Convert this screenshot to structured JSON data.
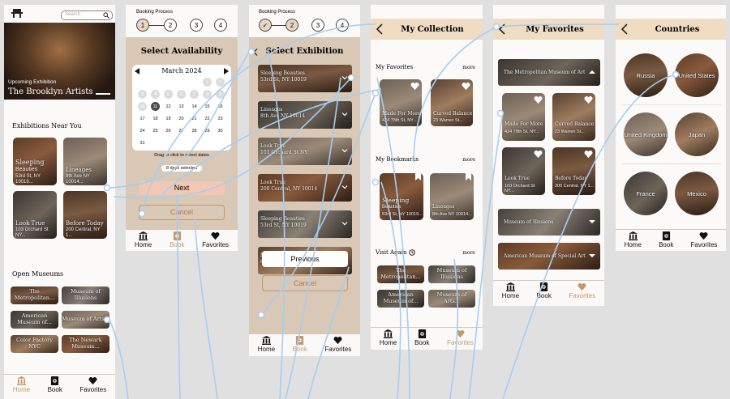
{
  "screen1": {
    "search_placeholder": "Search",
    "hero_kicker": "Upcoming Exhibition",
    "hero_title": "The Brooklyn Artists",
    "section_exhibitions": "Exhibitions Near You",
    "exhibitions": [
      {
        "title": "Sleeping",
        "subtitle": "Beauties",
        "address": "53rd St, NY 10019..."
      },
      {
        "title": "Lineages",
        "subtitle": "",
        "address": "8th Ave NY 10014..."
      },
      {
        "title": "Look True",
        "subtitle": "",
        "address": "103 Orchard St NY..."
      },
      {
        "title": "Before Today",
        "subtitle": "",
        "address": "200 Central, NY 1..."
      }
    ],
    "section_museums": "Open Museums",
    "museums": [
      "The Metropolitan...",
      "Museum of Illusions",
      "American Museum of...",
      "Museum of Arts...",
      "Color Factory NYC",
      "The Newark Museum..."
    ],
    "nav": [
      "Home",
      "Book",
      "Favorites"
    ]
  },
  "screen2": {
    "process_label": "Booking Process",
    "steps": [
      "1",
      "2",
      "3",
      "4"
    ],
    "title": "Select Availability",
    "month": "March 2024",
    "days": [
      "1",
      "2",
      "3",
      "4",
      "5",
      "6",
      "7",
      "8",
      "9",
      "10",
      "11",
      "12",
      "13",
      "14",
      "15",
      "16",
      "17",
      "18",
      "19",
      "20",
      "21",
      "22",
      "23",
      "24",
      "25",
      "26",
      "27",
      "28",
      "29",
      "30",
      "31"
    ],
    "selected_day": "11",
    "hint": "Drag or click to select dates",
    "days_selected": "8 days selected",
    "next_label": "Next",
    "cancel_label": "Cancel",
    "nav": [
      "Home",
      "Book",
      "Favorites"
    ]
  },
  "screen3": {
    "process_label": "Booking Process",
    "steps": [
      "✓",
      "2",
      "3",
      "4"
    ],
    "title": "Select Exhibition",
    "items": [
      {
        "title": "Sleeping Beauties",
        "address": "53rd St, NY 10019"
      },
      {
        "title": "Lineages",
        "address": "8th Ave NY 10014"
      },
      {
        "title": "Look True",
        "address": "103 Orchard St NY"
      },
      {
        "title": "Look True",
        "address": "200 Central, NY 10014"
      },
      {
        "title": "Sleeping Beauties",
        "address": "53rd St, NY 10019"
      },
      {
        "title": "Lineages",
        "address": "8th Ave NY 10014"
      }
    ],
    "previous_label": "Previous",
    "cancel_label": "Cancel",
    "nav": [
      "Home",
      "Book",
      "Favorites"
    ]
  },
  "screen4": {
    "title": "My Collection",
    "favorites_head": "My Favorites",
    "bookmarks_head": "My Bookmarks",
    "visit_head": "Visit Again",
    "more": "more",
    "favorites": [
      {
        "title": "Made For More",
        "address": "424 78th St, NY..."
      },
      {
        "title": "Curved Balance",
        "address": "23 Warren St..."
      }
    ],
    "bookmarks": [
      {
        "title": "Sleeping",
        "subtitle": "Beauties",
        "address": "53rd St, NY 10019..."
      },
      {
        "title": "Lineages",
        "subtitle": "",
        "address": "8th Ave NY 10014..."
      }
    ],
    "visit": [
      "The Metropolitan...",
      "Museum of Illusions",
      "American Museum of...",
      "Museum of Arts..."
    ],
    "nav": [
      "Home",
      "Book",
      "Favorites"
    ]
  },
  "screen5": {
    "title": "My Favorites",
    "museum_open": "The Metropolitan Museum of Art",
    "items": [
      {
        "title": "Made For More",
        "address": "424 78th St, NY..."
      },
      {
        "title": "Curved Balance",
        "address": "23 Warren St..."
      },
      {
        "title": "Look True",
        "address": "103 Orchard St NY..."
      },
      {
        "title": "Before Today",
        "address": "200 Central, NY 1..."
      }
    ],
    "museum_2": "Museum of Illusions",
    "museum_3": "American Museum of Special Art",
    "nav": [
      "Home",
      "Book",
      "Favorites"
    ]
  },
  "screen6": {
    "title": "Countries",
    "countries": [
      "Russia",
      "United States",
      "United Kingdom",
      "Japan",
      "France",
      "Mexico"
    ],
    "nav": [
      "Home",
      "Book",
      "Favorites"
    ]
  },
  "colors": {
    "background": "#e0e0e0",
    "accent": "#c19a6b",
    "panel": "#d8c8b5",
    "banner": "#efdcc2",
    "wire": "#a8cdf0",
    "next_button": "#f2c8b4"
  }
}
